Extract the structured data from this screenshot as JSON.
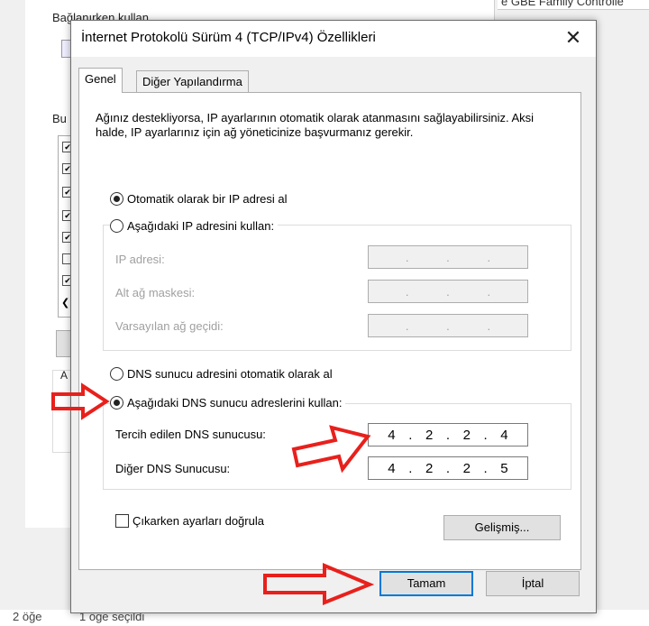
{
  "background": {
    "right_title": "e GBE Family Controlle",
    "label_top": "Bağlanırken kullan",
    "label_mid": "Bu",
    "label_low": "A",
    "status": {
      "items_count": "2 öğe",
      "selected": "1 öğe seçildi"
    }
  },
  "dialog": {
    "title": "İnternet Protokolü Sürüm 4 (TCP/IPv4) Özellikleri",
    "close_glyph": "✕",
    "tabs": [
      {
        "label": "Genel",
        "active": true
      },
      {
        "label": "Diğer Yapılandırma",
        "active": false
      }
    ],
    "description": "Ağınız destekliyorsa, IP ayarlarının otomatik olarak atanmasını sağlayabilirsiniz. Aksi halde, IP ayarlarınız için ağ yöneticinize başvurmanız gerekir.",
    "ip_section": {
      "auto_radio": "Otomatik olarak bir IP adresi al",
      "manual_radio": "Aşağıdaki IP adresini kullan:",
      "auto_selected": true,
      "fields": [
        {
          "label": "IP adresi:",
          "value": ". . ."
        },
        {
          "label": "Alt ağ maskesi:",
          "value": ". . ."
        },
        {
          "label": "Varsayılan ağ geçidi:",
          "value": ". . ."
        }
      ]
    },
    "dns_section": {
      "auto_radio": "DNS sunucu adresini otomatik olarak al",
      "manual_radio": "Aşağıdaki DNS sunucu adreslerini kullan:",
      "manual_selected": true,
      "preferred_label": "Tercih edilen DNS sunucusu:",
      "preferred_octets": [
        "4",
        "2",
        "2",
        "4"
      ],
      "alternate_label": "Diğer DNS Sunucusu:",
      "alternate_octets": [
        "4",
        "2",
        "2",
        "5"
      ]
    },
    "validate_checkbox": "Çıkarken ayarları doğrula",
    "validate_checked": false,
    "advanced_button": "Gelişmiş...",
    "ok_button": "Tamam",
    "cancel_button": "İptal"
  },
  "colors": {
    "annotation_arrow": "#e8201c",
    "dialog_bg": "#f0f0f0",
    "button_bg": "#e1e1e1",
    "default_button_border": "#0078d7"
  }
}
